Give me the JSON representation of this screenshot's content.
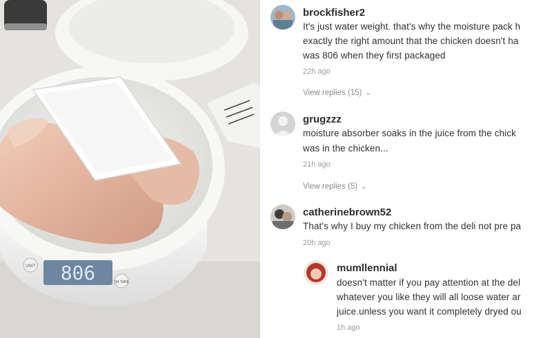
{
  "photo": {
    "scale_display": "806",
    "scale_left_button": "UNIT",
    "scale_right_button": "ON TARE"
  },
  "comments": [
    {
      "username": "brockfisher2",
      "lines": [
        "It's just water weight. that's why the moisture pack h",
        "exactly the right amount that the chicken doesn't ha",
        "was 806 when they first packaged"
      ],
      "time": "22h ago",
      "replies": "View replies (15)"
    },
    {
      "username": "grugzzz",
      "lines": [
        "moisture absorber soaks in the juice from the chick",
        "was in the chicken..."
      ],
      "time": "21h ago",
      "replies": "View replies (5)"
    },
    {
      "username": "catherinebrown52",
      "lines": [
        "That's why I buy my chicken from the deli not pre pa"
      ],
      "time": "20h ago"
    },
    {
      "username": "mumllennial",
      "lines": [
        "doesn't matter if you pay attention at the del",
        "whatever you like they will all loose water ar",
        "juice.unless you want it completely dryed ou"
      ],
      "time": "1h ago"
    }
  ]
}
